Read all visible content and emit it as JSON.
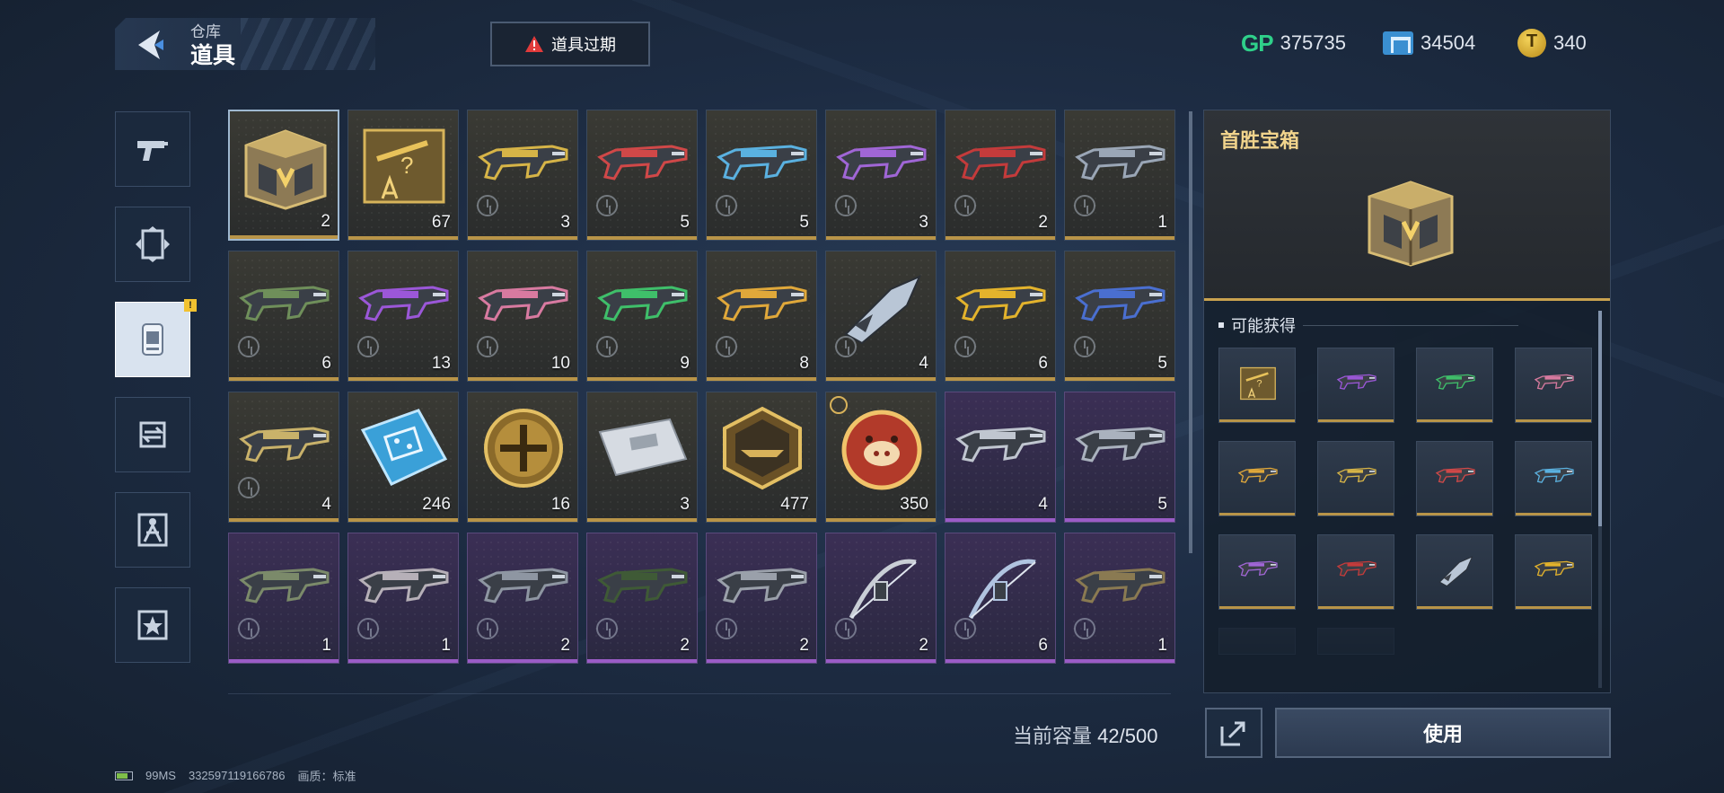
{
  "header": {
    "breadcrumb_parent": "仓库",
    "title": "道具",
    "expire_label": "道具过期"
  },
  "currencies": [
    {
      "name": "GP",
      "icon": "gp-icon",
      "value": "375735"
    },
    {
      "name": "ticket",
      "icon": "ticket-icon",
      "value": "34504"
    },
    {
      "name": "coin",
      "icon": "coin-icon",
      "value": "340"
    }
  ],
  "sidebar": {
    "items": [
      {
        "icon": "pistol-icon"
      },
      {
        "icon": "scroll-icon"
      },
      {
        "icon": "props-card-icon",
        "active": true,
        "badge": "!"
      },
      {
        "icon": "exchange-icon"
      },
      {
        "icon": "character-icon"
      },
      {
        "icon": "star-badge-icon"
      }
    ]
  },
  "items": [
    {
      "kind": "chest",
      "qty": "2",
      "rarity": "gold",
      "selected": true
    },
    {
      "kind": "blueprint",
      "qty": "67",
      "rarity": "gold"
    },
    {
      "kind": "gun",
      "color": "#d6b447",
      "qty": "3",
      "rarity": "gold",
      "timed": true
    },
    {
      "kind": "gun",
      "color": "#d04848",
      "qty": "5",
      "rarity": "gold",
      "timed": true
    },
    {
      "kind": "gun",
      "color": "#5ab1e0",
      "qty": "5",
      "rarity": "gold",
      "timed": true
    },
    {
      "kind": "gun",
      "color": "#a066d6",
      "qty": "3",
      "rarity": "gold",
      "timed": true
    },
    {
      "kind": "gun",
      "color": "#c43b3b",
      "qty": "2",
      "rarity": "gold",
      "timed": true
    },
    {
      "kind": "gun",
      "color": "#9aa6b6",
      "qty": "1",
      "rarity": "gold",
      "timed": true
    },
    {
      "kind": "gun",
      "color": "#6f8f5a",
      "qty": "6",
      "rarity": "gold",
      "timed": true
    },
    {
      "kind": "gun",
      "color": "#9b57d8",
      "qty": "13",
      "rarity": "gold",
      "timed": true
    },
    {
      "kind": "gun",
      "color": "#d87aa0",
      "qty": "10",
      "rarity": "gold",
      "timed": true
    },
    {
      "kind": "gun",
      "color": "#3fbf6a",
      "qty": "9",
      "rarity": "gold",
      "timed": true
    },
    {
      "kind": "gun",
      "color": "#e0a83a",
      "qty": "8",
      "rarity": "gold",
      "timed": true
    },
    {
      "kind": "knife",
      "color": "#b9c6d6",
      "qty": "4",
      "rarity": "gold",
      "timed": true
    },
    {
      "kind": "gun",
      "color": "#e3b32c",
      "qty": "6",
      "rarity": "gold",
      "timed": true
    },
    {
      "kind": "gun",
      "color": "#4a6fd0",
      "qty": "5",
      "rarity": "gold",
      "timed": true
    },
    {
      "kind": "gun",
      "color": "#c9b26a",
      "qty": "4",
      "rarity": "gold",
      "timed": true
    },
    {
      "kind": "chip",
      "qty": "246",
      "rarity": "gold"
    },
    {
      "kind": "medal",
      "qty": "16",
      "rarity": "gold"
    },
    {
      "kind": "card",
      "qty": "3",
      "rarity": "gold"
    },
    {
      "kind": "hexbadge",
      "qty": "477",
      "rarity": "gold"
    },
    {
      "kind": "pigcoin",
      "qty": "350",
      "rarity": "gold",
      "clock_top": true
    },
    {
      "kind": "gun",
      "color": "#c0c6d0",
      "qty": "4",
      "rarity": "purple"
    },
    {
      "kind": "gun",
      "color": "#aab2be",
      "qty": "5",
      "rarity": "purple"
    },
    {
      "kind": "gun",
      "color": "#7b8a6a",
      "qty": "1",
      "rarity": "purple",
      "timed": true
    },
    {
      "kind": "gun",
      "color": "#b6b0b8",
      "qty": "1",
      "rarity": "purple",
      "timed": true
    },
    {
      "kind": "gun",
      "color": "#8e96a2",
      "qty": "2",
      "rarity": "purple",
      "timed": true
    },
    {
      "kind": "gun",
      "color": "#3f5a36",
      "qty": "2",
      "rarity": "purple",
      "timed": true
    },
    {
      "kind": "gun",
      "color": "#9aa0aa",
      "qty": "2",
      "rarity": "purple",
      "timed": true
    },
    {
      "kind": "bow",
      "color": "#c9ced6",
      "qty": "2",
      "rarity": "purple",
      "timed": true
    },
    {
      "kind": "bow",
      "color": "#b0c4e0",
      "qty": "6",
      "rarity": "purple",
      "timed": true
    },
    {
      "kind": "gun",
      "color": "#8a7a52",
      "qty": "1",
      "rarity": "purple",
      "timed": true
    }
  ],
  "footer": {
    "capacity_label": "当前容量",
    "capacity_value": "42/500",
    "use_label": "使用",
    "status_ping": "99MS",
    "status_id": "332597119166786",
    "status_quality": "画质：标准"
  },
  "detail": {
    "title": "首胜宝箱",
    "possible_title": "可能获得",
    "possible_items": [
      {
        "kind": "blueprint",
        "color": "#d6b447"
      },
      {
        "kind": "gun",
        "color": "#9b57d8"
      },
      {
        "kind": "gun",
        "color": "#3fbf6a"
      },
      {
        "kind": "gun",
        "color": "#d87aa0"
      },
      {
        "kind": "gun",
        "color": "#e0a83a"
      },
      {
        "kind": "gun",
        "color": "#d6b447"
      },
      {
        "kind": "gun",
        "color": "#d04848"
      },
      {
        "kind": "gun",
        "color": "#5ab1e0"
      },
      {
        "kind": "gun",
        "color": "#a066d6"
      },
      {
        "kind": "gun",
        "color": "#c43b3b"
      },
      {
        "kind": "knife",
        "color": "#b9c6d6"
      },
      {
        "kind": "gun",
        "color": "#e3b32c"
      }
    ]
  },
  "colors": {
    "gold_accent": "#c9a24f",
    "purple_accent": "#9a5cc6",
    "title_gold": "#f1d48c",
    "gp_green": "#2fd08a"
  }
}
